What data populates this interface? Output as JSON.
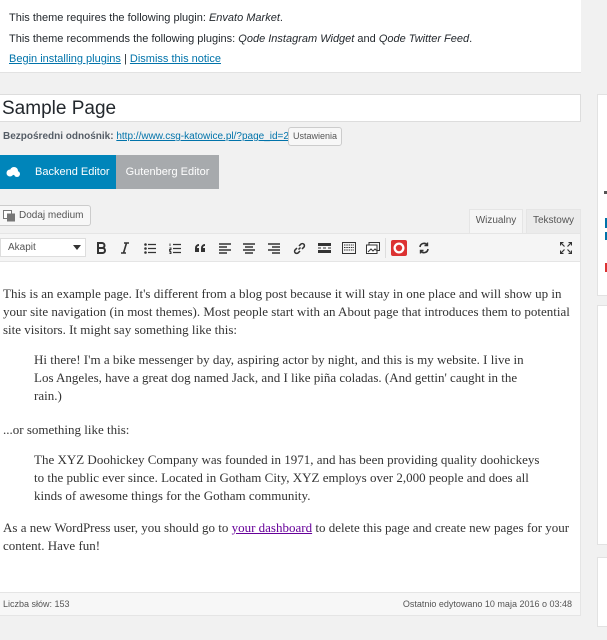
{
  "notice": {
    "line1_prefix": "This theme requires the following plugin: ",
    "line1_plugin": "Envato Market",
    "line1_suffix": ".",
    "line2_prefix": "This theme recommends the following plugins: ",
    "line2_plugin1": "Qode Instagram Widget",
    "line2_and": " and ",
    "line2_plugin2": "Qode Twitter Feed",
    "line2_suffix": ".",
    "begin_link": "Begin installing plugins",
    "separator": " | ",
    "dismiss_link": "Dismiss this notice"
  },
  "post": {
    "title": "Sample Page",
    "permalink_label": "Bezpośredni odnośnik:",
    "permalink_url": "http://www.csg-katowice.pl/?page_id=2",
    "permalink_button": "Ustawienia"
  },
  "editor_switch": {
    "backend": "Backend Editor",
    "gutenberg": "Gutenberg Editor"
  },
  "media": {
    "add_media": "Dodaj medium"
  },
  "tabs": {
    "visual": "Wizualny",
    "text": "Tekstowy"
  },
  "toolbar": {
    "format": "Akapit",
    "icons": [
      "bold-icon",
      "italic-icon",
      "bullet-list-icon",
      "numbered-list-icon",
      "blockquote-icon",
      "align-left-icon",
      "align-center-icon",
      "align-right-icon",
      "link-icon",
      "more-tag-icon",
      "toolbar-toggle-icon",
      "gallery-icon",
      "record-icon",
      "refresh-icon",
      "fullscreen-icon"
    ]
  },
  "content": {
    "p1": "This is an example page. It's different from a blog post because it will stay in one place and will show up in your site navigation (in most themes). Most people start with an About page that introduces them to potential site visitors. It might say something like this:",
    "quote1": "Hi there! I'm a bike messenger by day, aspiring actor by night, and this is my website. I live in Los Angeles, have a great dog named Jack, and I like piña coladas. (And gettin' caught in the rain.)",
    "p2": "...or something like this:",
    "quote2": "The XYZ Doohickey Company was founded in 1971, and has been providing quality doohickeys to the public ever since. Located in Gotham City, XYZ employs over 2,000 people and does all kinds of awesome things for the Gotham community.",
    "p3_prefix": "As a new WordPress user, you should go to ",
    "p3_link": "your dashboard",
    "p3_suffix": " to delete this page and create new pages for your content. Have fun!"
  },
  "status": {
    "word_count": "Liczba słów: 153",
    "last_edited": "Ostatnio edytowano 10 maja 2016 o 03:48"
  },
  "colors": {
    "accent": "#0085ba",
    "link": "#0073aa",
    "visited_link": "#660099",
    "record": "#dc3232"
  }
}
